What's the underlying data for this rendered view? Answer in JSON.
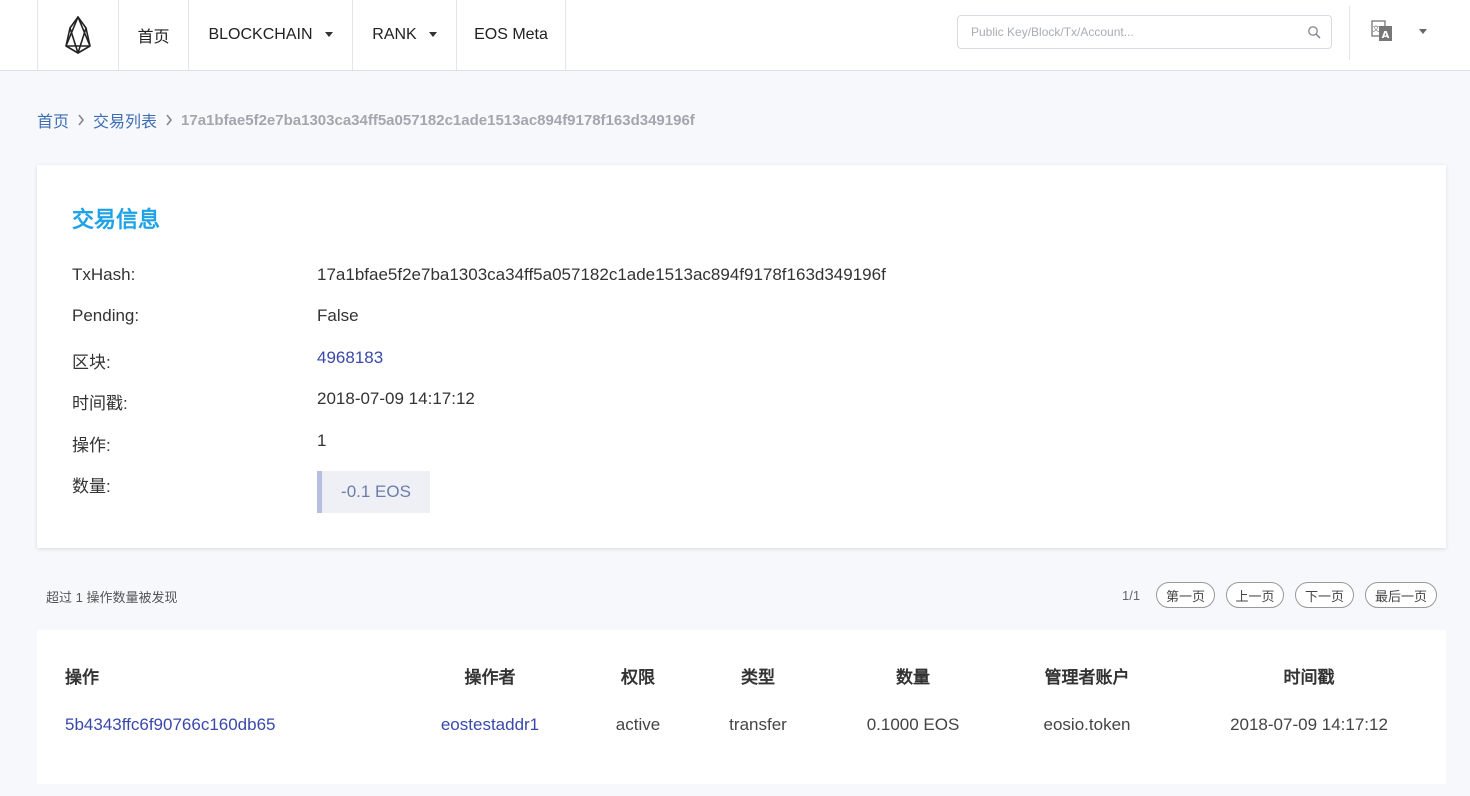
{
  "header": {
    "logo": "eos-logo-icon",
    "nav": [
      {
        "label": "首页",
        "dropdown": false
      },
      {
        "label": "BLOCKCHAIN",
        "dropdown": true
      },
      {
        "label": "RANK",
        "dropdown": true
      },
      {
        "label": "EOS Meta",
        "dropdown": false
      }
    ],
    "search": {
      "placeholder": "Public Key/Block/Tx/Account...",
      "value": ""
    },
    "language_icon": "translate-icon"
  },
  "breadcrumb": {
    "home": "首页",
    "list": "交易列表",
    "current": "17a1bfae5f2e7ba1303ca34ff5a057182c1ade1513ac894f9178f163d349196f"
  },
  "transaction": {
    "title": "交易信息",
    "rows": [
      {
        "label": "TxHash:",
        "value": "17a1bfae5f2e7ba1303ca34ff5a057182c1ade1513ac894f9178f163d349196f"
      },
      {
        "label": "Pending:",
        "value": "False"
      },
      {
        "label": "区块:",
        "value": "4968183"
      },
      {
        "label": "时间戳:",
        "value": "2018-07-09 14:17:12"
      },
      {
        "label": "操作:",
        "value": "1"
      }
    ],
    "amount_label": "数量:",
    "amount": "-0.1 EOS"
  },
  "pagination": {
    "found_text": "超过 1 操作数量被发现",
    "page_count": "1/1",
    "first": "第一页",
    "prev": "上一页",
    "next": "下一页",
    "last": "最后一页"
  },
  "actions_table": {
    "headers": [
      "操作",
      "操作者",
      "权限",
      "类型",
      "数量",
      "管理者账户",
      "时间戳"
    ],
    "rows": [
      [
        "5b4343ffc6f90766c160db65",
        "eostestaddr1",
        "active",
        "transfer",
        "0.1000 EOS",
        "eosio.token",
        "2018-07-09 14:17:12"
      ]
    ]
  },
  "colors": {
    "accent_title": "#1fa3e6",
    "link": "#3949ab",
    "breadcrumb_link": "#3f6db5",
    "page_bg": "#f7f8fc"
  }
}
